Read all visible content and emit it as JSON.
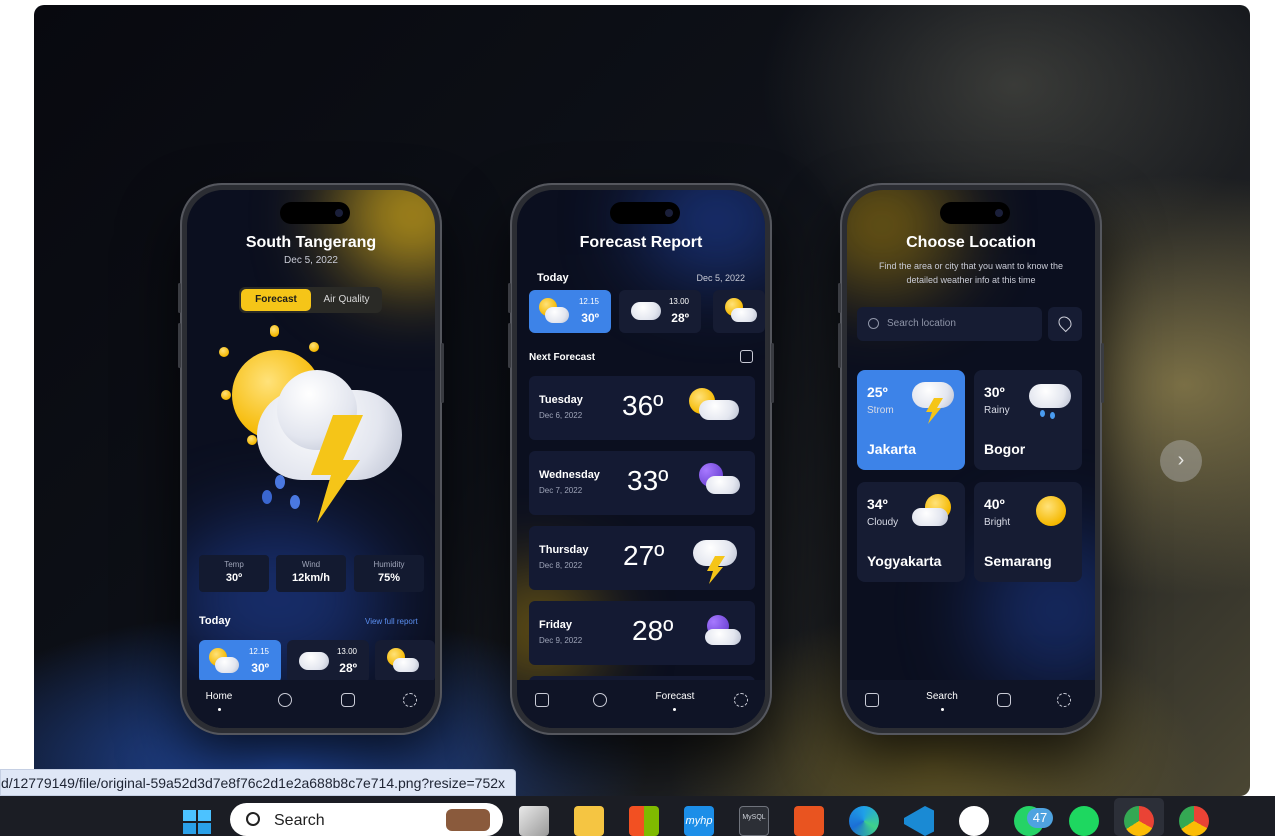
{
  "phone1": {
    "city": "South Tangerang",
    "date": "Dec 5, 2022",
    "tabs": [
      "Forecast",
      "Air Quality"
    ],
    "stats": [
      {
        "label": "Temp",
        "value": "30º"
      },
      {
        "label": "Wind",
        "value": "12km/h"
      },
      {
        "label": "Humidity",
        "value": "75%"
      }
    ],
    "today_label": "Today",
    "view_full": "View full report",
    "hours": [
      {
        "time": "12.15",
        "temp": "30º"
      },
      {
        "time": "13.00",
        "temp": "28º"
      }
    ],
    "nav": {
      "home": "Home"
    }
  },
  "phone2": {
    "title": "Forecast Report",
    "today_label": "Today",
    "today_date": "Dec 5, 2022",
    "hours": [
      {
        "time": "12.15",
        "temp": "30º"
      },
      {
        "time": "13.00",
        "temp": "28º"
      }
    ],
    "next_label": "Next Forecast",
    "forecast": [
      {
        "day": "Tuesday",
        "date": "Dec 6, 2022",
        "temp": "36º"
      },
      {
        "day": "Wednesday",
        "date": "Dec 7, 2022",
        "temp": "33º"
      },
      {
        "day": "Thursday",
        "date": "Dec 8, 2022",
        "temp": "27º"
      },
      {
        "day": "Friday",
        "date": "Dec 9, 2022",
        "temp": "28º"
      }
    ],
    "nav": {
      "forecast": "Forecast"
    }
  },
  "phone3": {
    "title": "Choose Location",
    "subtitle1": "Find the area or city that you want to know the",
    "subtitle2": "detailed weather info at this time",
    "search_placeholder": "Search location",
    "locations": [
      {
        "temp": "25º",
        "cond": "Strom",
        "city": "Jakarta"
      },
      {
        "temp": "30º",
        "cond": "Rainy",
        "city": "Bogor"
      },
      {
        "temp": "34º",
        "cond": "Cloudy",
        "city": "Yogyakarta"
      },
      {
        "temp": "40º",
        "cond": "Bright",
        "city": "Semarang"
      }
    ],
    "nav": {
      "search": "Search"
    }
  },
  "status_url": "d/12779149/file/original-59a52d3d7e8f76c2d1e2a688b8c7e714.png?resize=752x",
  "taskbar": {
    "search_label": "Search",
    "whatsapp_badge": "47",
    "apps": [
      "windows-start",
      "search",
      "task-view",
      "file-explorer",
      "microsoft-store",
      "myhp",
      "mysql",
      "ubuntu",
      "edge",
      "vscode",
      "phone-link",
      "whatsapp",
      "spotify",
      "chrome-profile",
      "chrome"
    ]
  },
  "colors": {
    "accent_yellow": "#f5c518",
    "accent_blue": "#3d83e8",
    "card_bg": "#161c33"
  }
}
